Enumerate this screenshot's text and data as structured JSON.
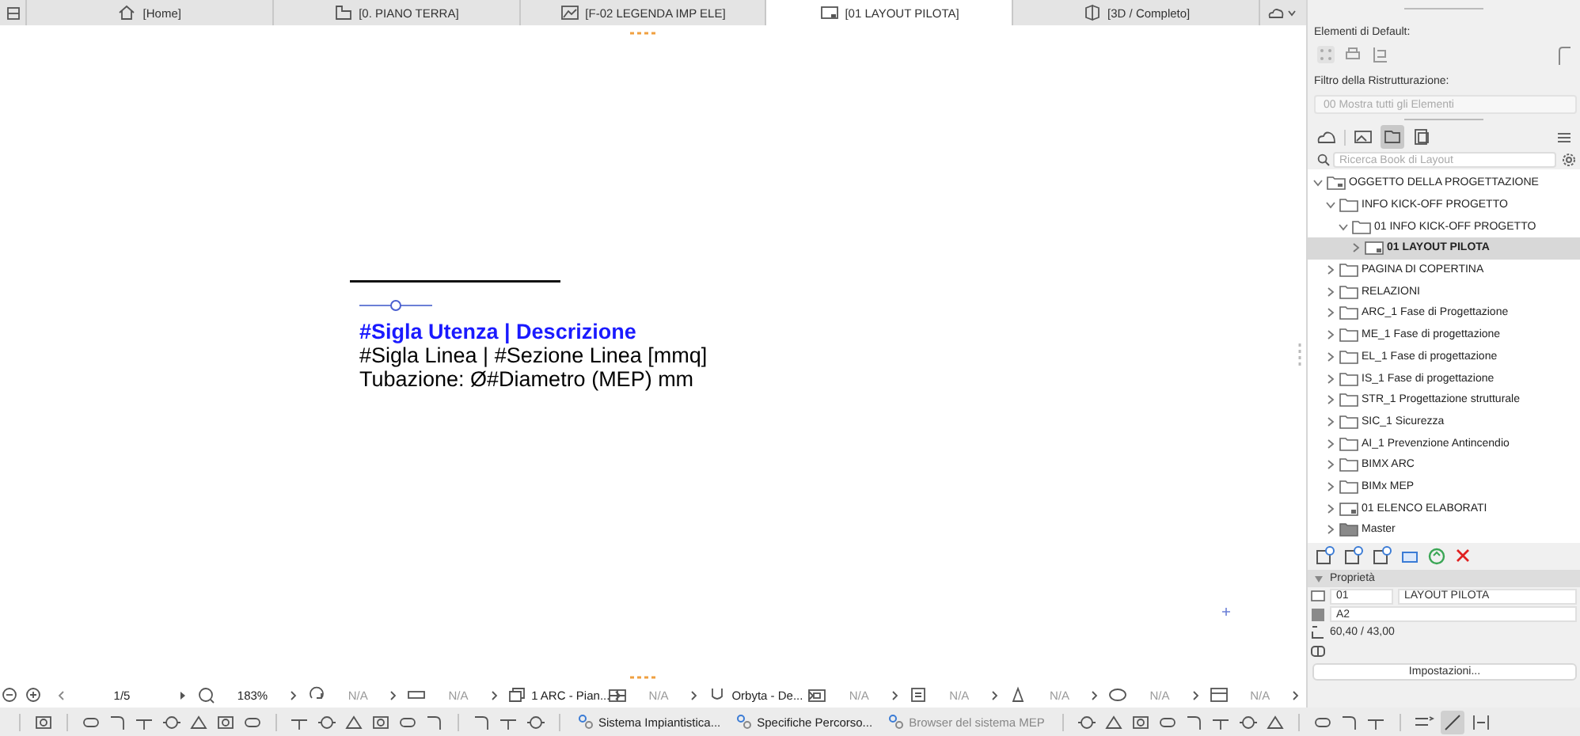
{
  "tabs": [
    {
      "label": "[Home]",
      "kind": "home",
      "selected": false
    },
    {
      "label": "[0. PIANO TERRA]",
      "kind": "plan",
      "selected": false
    },
    {
      "label": "[F-02 LEGENDA IMP ELE]",
      "kind": "drawing",
      "selected": false
    },
    {
      "label": "[01 LAYOUT PILOTA]",
      "kind": "layout",
      "selected": true
    },
    {
      "label": "[3D / Completo]",
      "kind": "cube",
      "selected": false
    }
  ],
  "canvas": {
    "label_lines": [
      {
        "text": "#Sigla Utenza | Descrizione",
        "kind": "title"
      },
      {
        "text": "#Sigla Linea | #Sezione Linea [mmq]",
        "kind": "body"
      },
      {
        "text": "Tubazione: Ø#Diametro (MEP) mm",
        "kind": "body"
      }
    ]
  },
  "navigator_bar": {
    "page": "1/5",
    "zoom": "183%",
    "fields": [
      {
        "text": "N/A",
        "disabled": true
      },
      {
        "text": "N/A",
        "disabled": true
      },
      {
        "text": "1 ARC - Pian...",
        "disabled": false
      },
      {
        "text": "N/A",
        "disabled": true
      },
      {
        "text": "Orbyta - De...",
        "disabled": false
      },
      {
        "text": "N/A",
        "disabled": true
      },
      {
        "text": "N/A",
        "disabled": true
      },
      {
        "text": "N/A",
        "disabled": true
      },
      {
        "text": "N/A",
        "disabled": true
      },
      {
        "text": "N/A",
        "disabled": true
      }
    ]
  },
  "toolbar": {
    "buttons": [
      {
        "label": "Sistema Impiantistica...",
        "disabled": false
      },
      {
        "label": "Specifiche Percorso...",
        "disabled": false
      },
      {
        "label": "Browser del sistema MEP",
        "disabled": true
      }
    ]
  },
  "sidebar": {
    "defaults_label": "Elementi di Default:",
    "filter_label": "Filtro della Ristrutturazione:",
    "filter_value": "00 Mostra tutti gli Elementi",
    "search": {
      "placeholder": "Ricerca Book di Layout"
    },
    "tree": [
      {
        "label": "OGGETTO DELLA PROGETTAZIONE",
        "kind": "book",
        "expanded": true,
        "selected": false,
        "children": [
          {
            "label": "INFO KICK-OFF PROGETTO",
            "kind": "folder",
            "expanded": true,
            "selected": false,
            "children": [
              {
                "label": "01 INFO KICK-OFF PROGETTO",
                "kind": "folder",
                "expanded": true,
                "selected": false,
                "children": [
                  {
                    "label": "01 LAYOUT PILOTA",
                    "kind": "layout",
                    "expanded": false,
                    "selected": true
                  }
                ]
              }
            ]
          },
          {
            "label": "PAGINA DI COPERTINA",
            "kind": "folder",
            "expanded": false,
            "selected": false
          },
          {
            "label": "RELAZIONI",
            "kind": "folder",
            "expanded": false,
            "selected": false
          },
          {
            "label": "ARC_1 Fase di Progettazione",
            "kind": "folder",
            "expanded": false,
            "selected": false
          },
          {
            "label": "ME_1 Fase di progettazione",
            "kind": "folder",
            "expanded": false,
            "selected": false
          },
          {
            "label": "EL_1 Fase di progettazione",
            "kind": "folder",
            "expanded": false,
            "selected": false
          },
          {
            "label": "IS_1 Fase di progettazione",
            "kind": "folder",
            "expanded": false,
            "selected": false
          },
          {
            "label": "STR_1 Progettazione strutturale",
            "kind": "folder",
            "expanded": false,
            "selected": false
          },
          {
            "label": "SIC_1 Sicurezza",
            "kind": "folder",
            "expanded": false,
            "selected": false
          },
          {
            "label": "AI_1 Prevenzione Antincendio",
            "kind": "folder",
            "expanded": false,
            "selected": false
          },
          {
            "label": "BIMX ARC",
            "kind": "folder",
            "expanded": false,
            "selected": false
          },
          {
            "label": "BIMx MEP",
            "kind": "folder",
            "expanded": false,
            "selected": false
          },
          {
            "label": "01 ELENCO ELABORATI",
            "kind": "layout",
            "expanded": false,
            "selected": false
          },
          {
            "label": "Master",
            "kind": "master",
            "expanded": false,
            "selected": false
          }
        ]
      }
    ],
    "properties": {
      "title": "Proprietà",
      "expanded": true,
      "id": "01",
      "name": "LAYOUT PILOTA",
      "size": "A2",
      "dimensions": "60,40 / 43,00",
      "settings_button": "Impostazioni..."
    }
  }
}
